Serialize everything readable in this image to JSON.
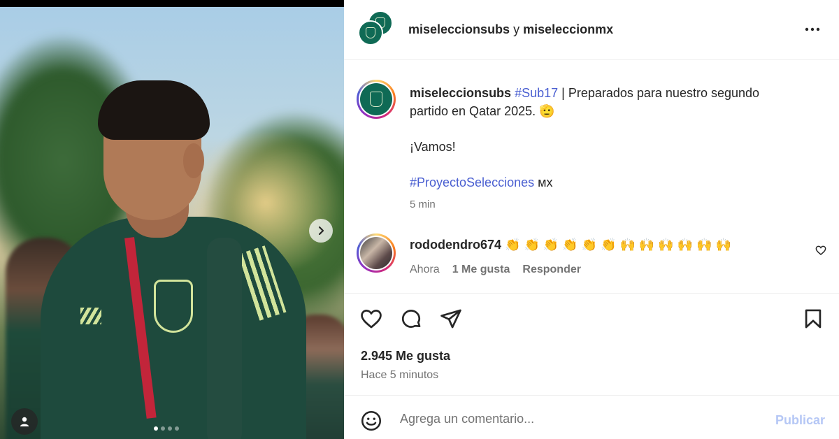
{
  "post": {
    "authors_primary": "miseleccionsubs",
    "authors_joiner": " y ",
    "authors_secondary": "miseleccionmx",
    "more_icon": "more-horizontal-icon"
  },
  "caption": {
    "username": "miseleccionsubs",
    "hashtag1": "#Sub17",
    "text1": " | Preparados para nuestro segundo partido en Qatar 2025. ",
    "emoji1": "🫡",
    "text2": "¡Vamos!",
    "hashtag2": "#ProyectoSelecciones",
    "text3": " ᴍx",
    "time": "5 min"
  },
  "comment": {
    "username": "rododendro674",
    "text": " 👏 👏 👏 👏 👏 👏 🙌 🙌 🙌 🙌 🙌 🙌",
    "time": "Ahora",
    "likes": "1 Me gusta",
    "reply": "Responder"
  },
  "stats": {
    "likes": "2.945 Me gusta",
    "posted": "Hace 5 minutos"
  },
  "composer": {
    "placeholder": "Agrega un comentario...",
    "publish": "Publicar"
  },
  "carousel": {
    "slides": 4,
    "current": 1
  },
  "colors": {
    "accent_link": "#4a5fd1",
    "publish_disabled": "#b5c7f5",
    "team_green": "#0f6a55"
  }
}
